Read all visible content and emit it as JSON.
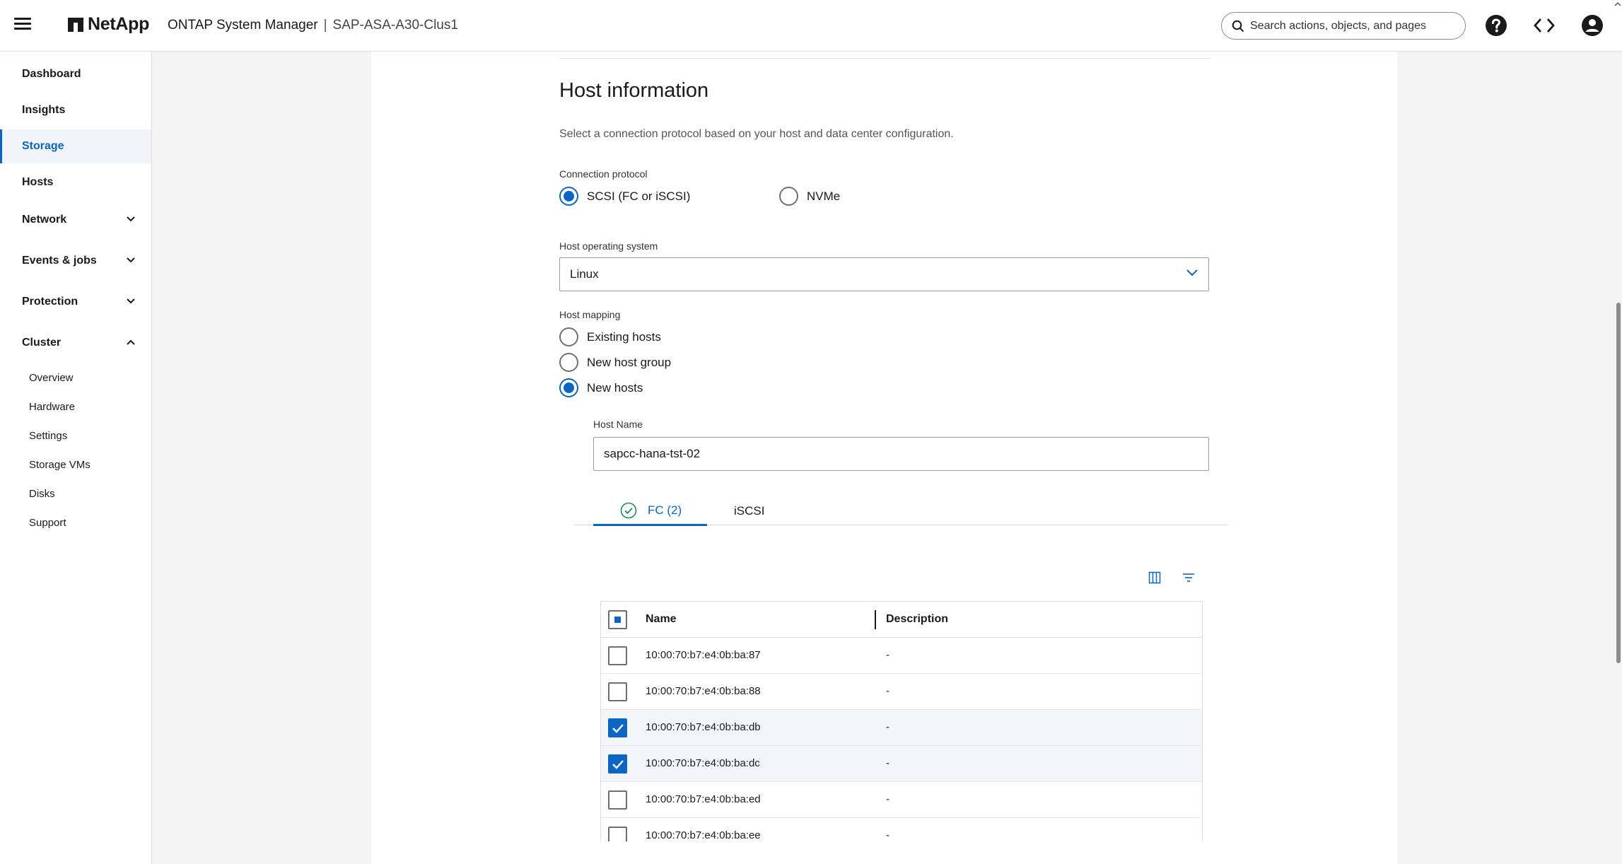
{
  "header": {
    "brand": "NetApp",
    "app_title": "ONTAP System Manager",
    "separator": "|",
    "cluster_name": "SAP-ASA-A30-Clus1",
    "search_placeholder": "Search actions, objects, and pages"
  },
  "sidebar": {
    "items": [
      {
        "label": "Dashboard"
      },
      {
        "label": "Insights"
      },
      {
        "label": "Storage"
      },
      {
        "label": "Hosts"
      },
      {
        "label": "Network"
      },
      {
        "label": "Events & jobs"
      },
      {
        "label": "Protection"
      },
      {
        "label": "Cluster"
      }
    ],
    "cluster_subitems": [
      {
        "label": "Overview"
      },
      {
        "label": "Hardware"
      },
      {
        "label": "Settings"
      },
      {
        "label": "Storage VMs"
      },
      {
        "label": "Disks"
      },
      {
        "label": "Support"
      }
    ]
  },
  "form": {
    "title": "Host information",
    "description": "Select a connection protocol based on your host and data center configuration.",
    "connection_protocol": {
      "label": "Connection protocol",
      "options": [
        {
          "label": "SCSI (FC or iSCSI)",
          "checked": true
        },
        {
          "label": "NVMe",
          "checked": false
        }
      ]
    },
    "host_os": {
      "label": "Host operating system",
      "value": "Linux"
    },
    "host_mapping": {
      "label": "Host mapping",
      "options": [
        {
          "label": "Existing hosts",
          "checked": false
        },
        {
          "label": "New host group",
          "checked": false
        },
        {
          "label": "New hosts",
          "checked": true
        }
      ]
    },
    "host_name": {
      "label": "Host Name",
      "value": "sapcc-hana-tst-02"
    },
    "tabs": [
      {
        "label": "FC (2)",
        "active": true
      },
      {
        "label": "iSCSI",
        "active": false
      }
    ],
    "table": {
      "columns": [
        "Name",
        "Description"
      ],
      "rows": [
        {
          "name": "10:00:70:b7:e4:0b:ba:87",
          "description": "-",
          "checked": false
        },
        {
          "name": "10:00:70:b7:e4:0b:ba:88",
          "description": "-",
          "checked": false
        },
        {
          "name": "10:00:70:b7:e4:0b:ba:db",
          "description": "-",
          "checked": true
        },
        {
          "name": "10:00:70:b7:e4:0b:ba:dc",
          "description": "-",
          "checked": true
        },
        {
          "name": "10:00:70:b7:e4:0b:ba:ed",
          "description": "-",
          "checked": false
        },
        {
          "name": "10:00:70:b7:e4:0b:ba:ee",
          "description": "-",
          "checked": false
        }
      ]
    }
  },
  "colors": {
    "accent": "#0b66c3",
    "success": "#1e8a5c"
  }
}
